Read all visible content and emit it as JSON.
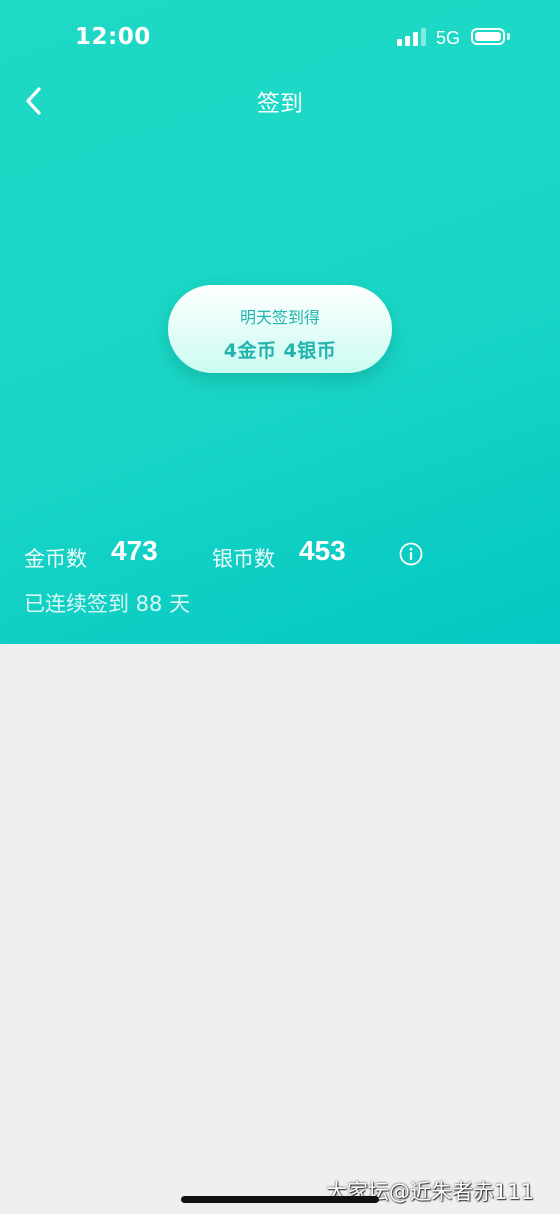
{
  "status_bar": {
    "time": "12:00",
    "network": "5G"
  },
  "nav": {
    "back_icon": "chevron-left-icon",
    "title": "签到"
  },
  "reward": {
    "line1": "明天签到得",
    "line2": "4金币 4银币"
  },
  "stats": {
    "gold_label": "金币数",
    "gold_value": "473",
    "silver_label": "银币数",
    "silver_value": "453",
    "info_icon": "info-icon",
    "streak_text": "已连续签到 88 天"
  },
  "watermark": "大家坛@近朱者赤111",
  "colors": {
    "hero_start": "#1ed9c5",
    "hero_end": "#03c7c2",
    "accent_text": "#22b3ad",
    "page_background": "#eeeff1"
  }
}
